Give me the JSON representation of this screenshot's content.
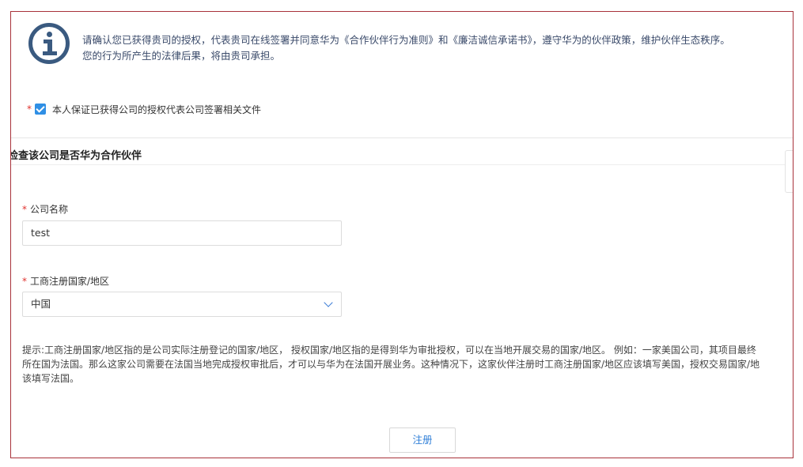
{
  "notice": {
    "line1": "请确认您已获得贵司的授权，代表贵司在线签署并同意华为《合作伙伴行为准则》和《廉洁诚信承诺书》，遵守华为的伙伴政策，维护伙伴生态秩序。",
    "line2": "您的行为所产生的法律后果，将由贵司承担。"
  },
  "consent": {
    "required_mark": "*",
    "label": "本人保证已获得公司的授权代表公司签署相关文件",
    "checked": true
  },
  "section": {
    "title": "检查该公司是否华为合作伙伴"
  },
  "form": {
    "company_name": {
      "required_mark": "*",
      "label": "公司名称",
      "value": "test"
    },
    "country": {
      "required_mark": "*",
      "label": "工商注册国家/地区",
      "value": "中国"
    }
  },
  "hint": {
    "line1": "提示:工商注册国家/地区指的是公司实际注册登记的国家/地区， 授权国家/地区指的是得到华为审批授权，可以在当地开展交易的国家/地区。 例如：一家美国公司，其项目最终",
    "line2": "所在国为法国。那么这家公司需要在法国当地完成授权审批后，才可以与华为在法国开展业务。这种情况下，这家伙伴注册时工商注册国家/地区应该填写美国，授权交易国家/地",
    "line3": "该填写法国。"
  },
  "submit_label": "注册",
  "colors": {
    "frame_border": "#a8323a",
    "accent": "#2f8fe5",
    "required": "#e0332f",
    "info_icon": "#3a5a80"
  }
}
